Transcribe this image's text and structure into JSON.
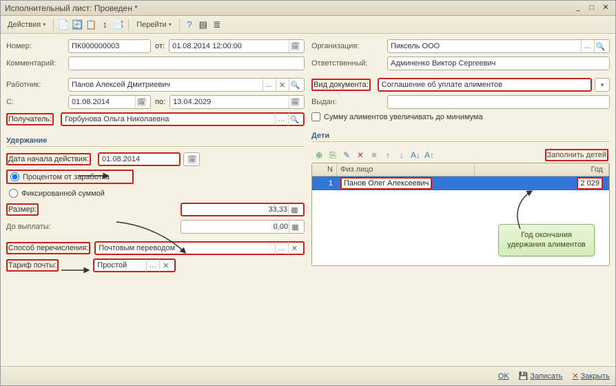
{
  "title": "Исполнительный лист: Проведен *",
  "toolbar": {
    "actions": "Действия",
    "goto": "Перейти"
  },
  "left": {
    "number_label": "Номер:",
    "number": "ПК000000003",
    "from_label": "от:",
    "date": "01.08.2014 12:00:00",
    "comment_label": "Комментарий:",
    "worker_label": "Работник:",
    "worker": "Панов Алексей Дмитриевич",
    "since_label": "С:",
    "since": "01.08.2014",
    "until_label": "по:",
    "until": "13.04.2029",
    "recip_label": "Получатель:",
    "recip": "Горбунова Ольга Николаевна",
    "deduction_head": "Удержание",
    "start_label": "Дата начала действия:",
    "start": "01.08.2014",
    "radio1": "Процентом от заработка",
    "radio2": "Фиксированной суммой",
    "size_label": "Размер:",
    "size": "33,33",
    "upto_label": "До выплаты:",
    "upto": "0,00",
    "method_label": "Способ перечисления:",
    "method": "Почтовым переводом",
    "tariff_label": "Тариф почты:",
    "tariff": "Простой"
  },
  "right": {
    "org_label": "Организация:",
    "org": "Пиксель ООО",
    "resp_label": "Ответственный:",
    "resp": "Админенко Виктор Сергеевич",
    "doctype_label": "Вид документа:",
    "doctype": "Соглашение об уплате алиментов",
    "issued_label": "Выдан:",
    "minimum_label": "Сумму алиментов увеличивать до минимума",
    "kids_head": "Дети",
    "fill_kids": "Заполнить детей",
    "col_n": "N",
    "col_fio": "Физ лицо",
    "col_year": "Год",
    "row_n": "1",
    "row_fio": "Панов Олег Алексеевич",
    "row_year": "2 029"
  },
  "callout": "Год окончания удержания алиментов",
  "footer": {
    "ok": "OK",
    "save": "Записать",
    "close": "Закрыть"
  }
}
